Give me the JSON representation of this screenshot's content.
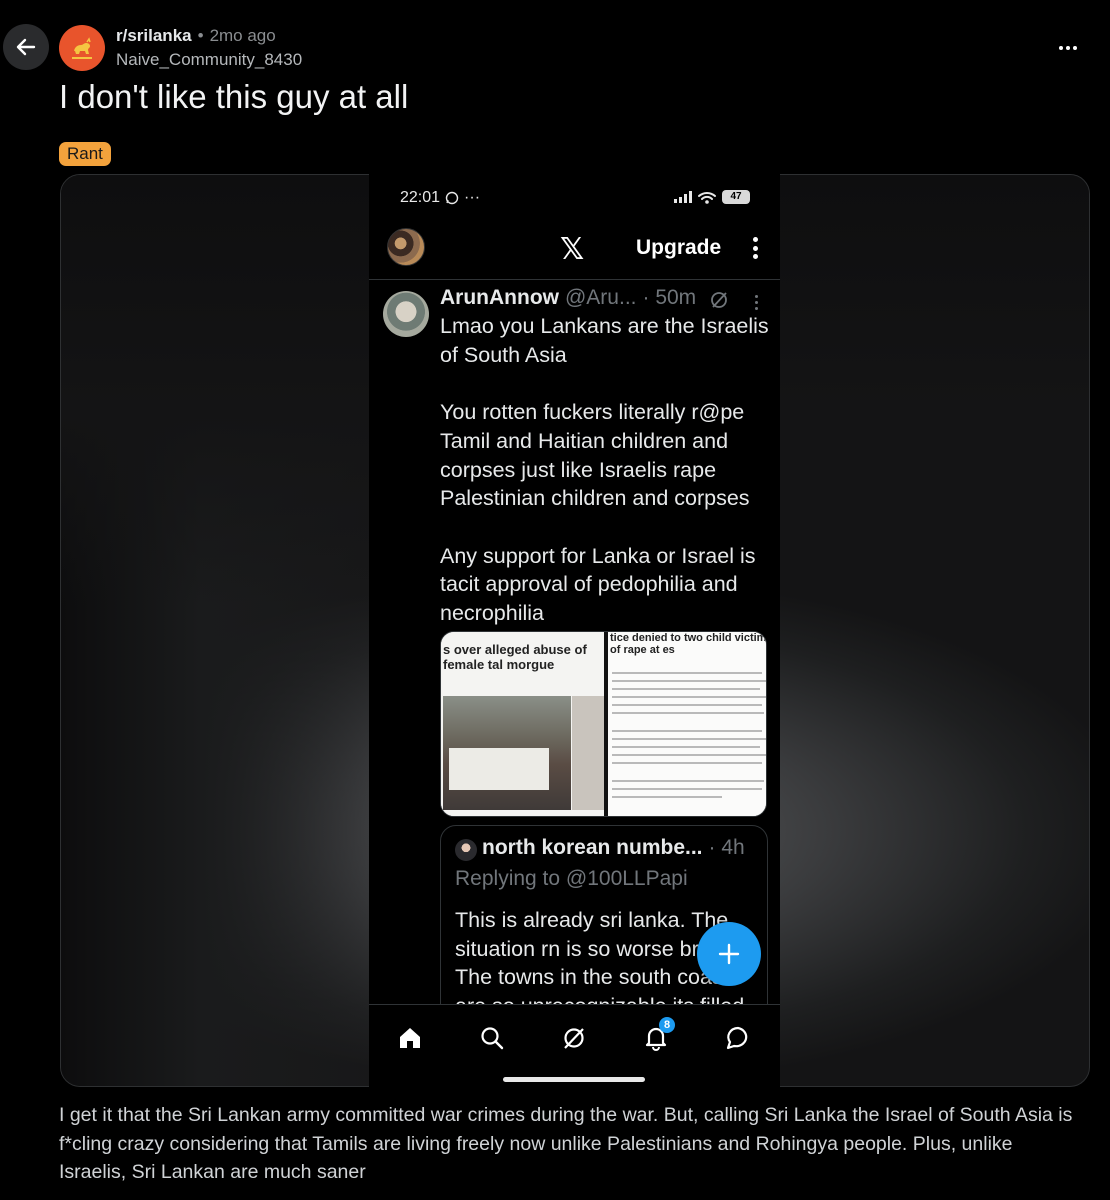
{
  "header": {
    "subreddit": "r/srilanka",
    "separator": "•",
    "time_ago": "2mo ago",
    "author": "Naive_Community_8430"
  },
  "post": {
    "title": "I don't like this guy at all",
    "flair": "Rant",
    "flair_color": "#f3a23c",
    "body": "I get it that the Sri Lankan army committed war crimes during the war. But, calling Sri Lanka the Israel of South Asia is f*cling crazy considering that Tamils are living freely now unlike Palestinians and Rohingya people. Plus, unlike Israelis, Sri Lankan are much saner"
  },
  "screenshot": {
    "status": {
      "time": "22:01",
      "dots": "···",
      "battery": "47"
    },
    "topbar": {
      "logo": "𝕏",
      "upgrade_label": "Upgrade"
    },
    "tweet": {
      "name": "ArunAnnow",
      "handle": "@Aru...",
      "time": "· 50m",
      "paragraphs": [
        "Lmao you Lankans are the Israelis of South Asia",
        "You rotten fuckers literally r@pe Tamil and Haitian children and corpses just like Israelis rape Palestinian children and corpses",
        "Any support for Lanka or Israel is tacit approval of pedophilia and necrophilia"
      ],
      "media_left_headline": "s over alleged abuse of female tal morgue",
      "media_right_headline": "tice denied to two child victims of rape at es"
    },
    "quoted": {
      "name": "north korean numbe...",
      "time": "· 4h",
      "replying_to": "Replying to @100LLPapi",
      "text": "This is already sri lanka. The situation rn is so worse bro. The towns in the south coast are so unrecognizable its filled"
    },
    "tabbar": {
      "notification_count": "8"
    },
    "accent_color": "#1d9bf0"
  }
}
